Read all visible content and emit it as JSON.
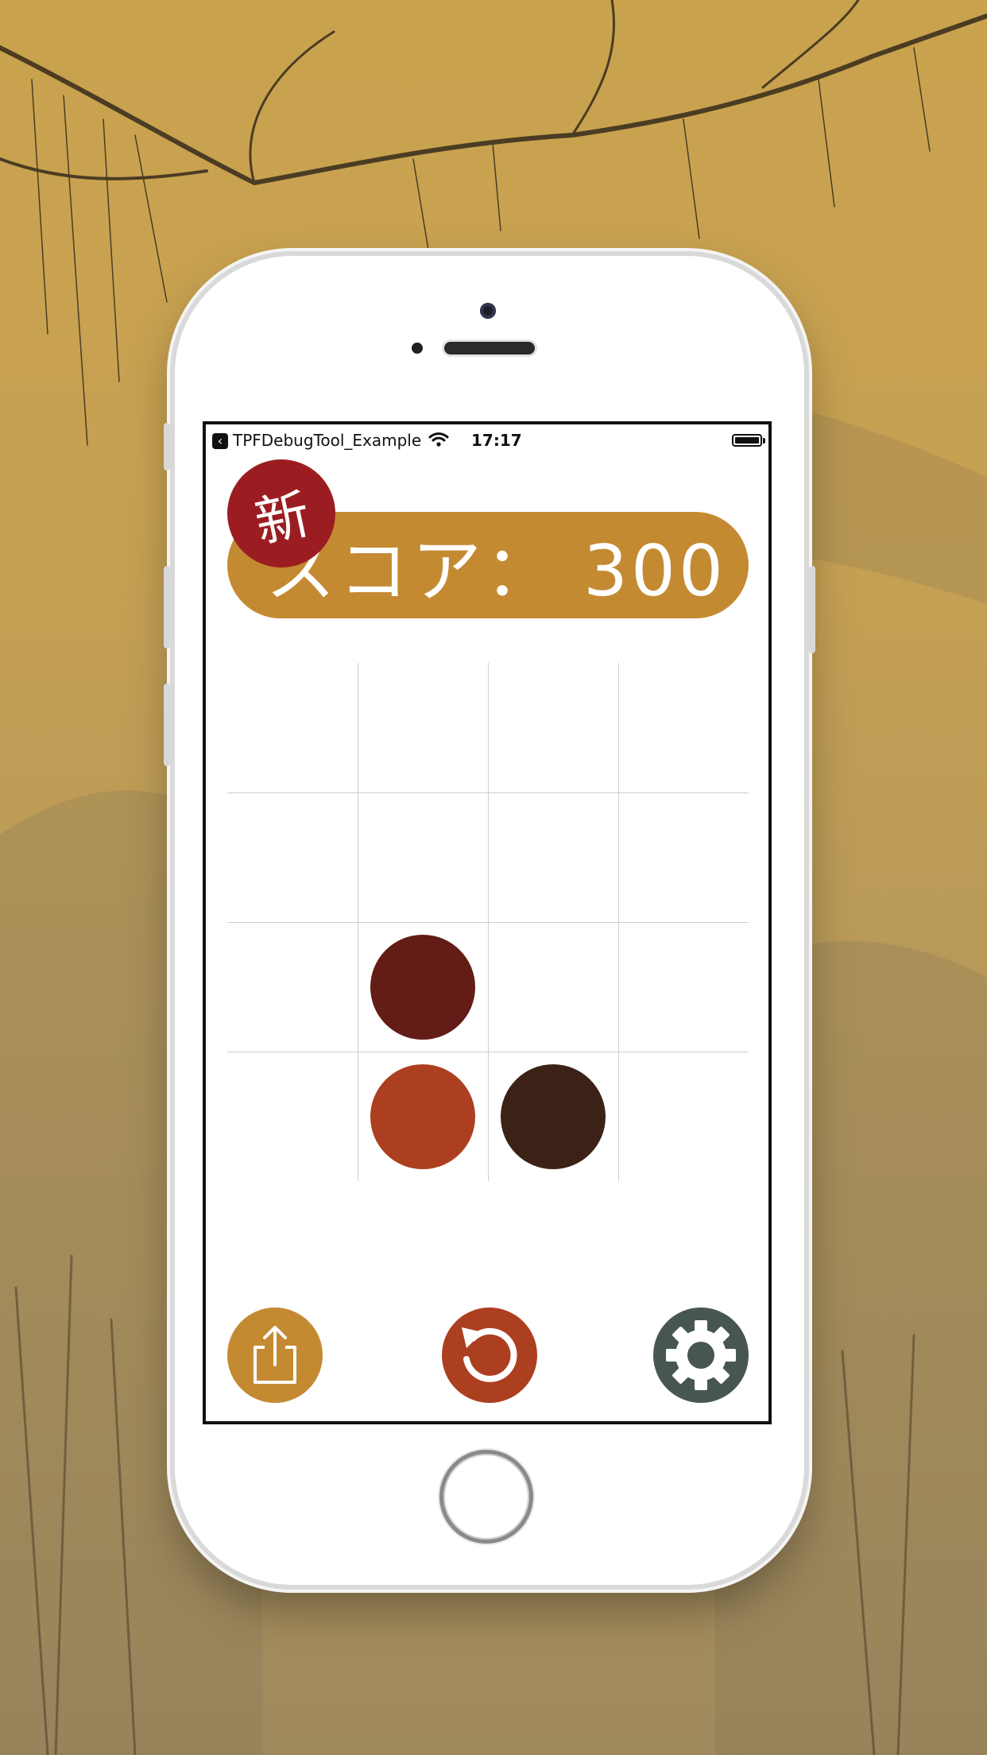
{
  "colors": {
    "background": "#c9a24e",
    "score_pill": "#c48a32",
    "new_badge": "#9b1d22",
    "share_button": "#c48a32",
    "restart_button": "#ac3f20",
    "settings_button": "#475651"
  },
  "status_bar": {
    "back_icon": "chevron-left-icon",
    "app_name": "TPFDebugTool_Example",
    "wifi_icon": "wifi-icon",
    "time": "17:17",
    "battery_icon": "battery-full-icon"
  },
  "header": {
    "new_badge": "新",
    "score_text": "スコア： 300"
  },
  "board": {
    "rows": 4,
    "cols": 4,
    "pieces": [
      {
        "row": 2,
        "col": 1,
        "color": "#631c16"
      },
      {
        "row": 3,
        "col": 1,
        "color": "#ac3f20"
      },
      {
        "row": 3,
        "col": 2,
        "color": "#3c2216"
      }
    ]
  },
  "controls": {
    "share_icon": "share-icon",
    "restart_icon": "restart-icon",
    "settings_icon": "gear-icon"
  }
}
